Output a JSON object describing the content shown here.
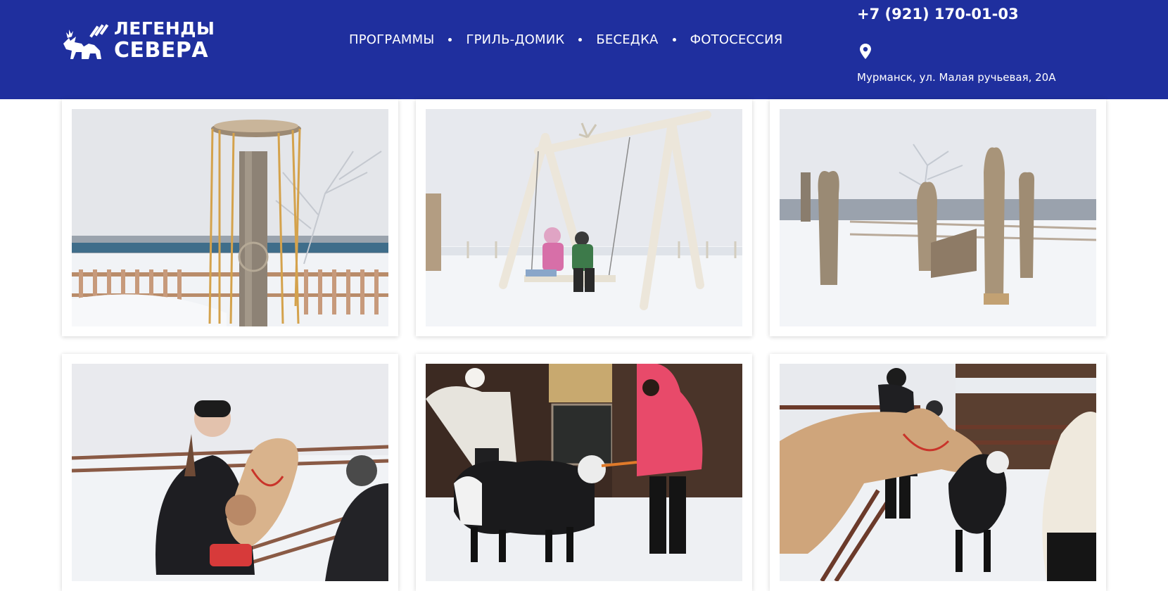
{
  "brand": {
    "line1": "ЛЕГЕНДЫ",
    "line2": "СЕВЕРА",
    "logo_icon": "reindeer-logo-icon"
  },
  "nav": {
    "items": [
      {
        "label": "ПРОГРАММЫ"
      },
      {
        "label": "ГРИЛЬ-ДОМИК"
      },
      {
        "label": "БЕСЕДКА"
      },
      {
        "label": "ФОТОСЕССИЯ"
      }
    ]
  },
  "contacts": {
    "phone": "+7 (921) 170-01-03",
    "address": "Мурманск, ул. Малая ручьевая, 20А",
    "address_icon": "location-pin-icon"
  },
  "colors": {
    "header_bg": "#1f2f9e",
    "text_on_header": "#ffffff",
    "page_bg": "#ffffff"
  },
  "gallery": {
    "photos": [
      {
        "subject": "wooden totem pole with rope wheel in snow"
      },
      {
        "subject": "children on wooden swing in snow"
      },
      {
        "subject": "carved wooden animal sculptures in snow"
      },
      {
        "subject": "girl feeding pony in snowy pen"
      },
      {
        "subject": "girls feeding black-and-white goat"
      },
      {
        "subject": "pony and goat at fence with visitors"
      }
    ]
  }
}
